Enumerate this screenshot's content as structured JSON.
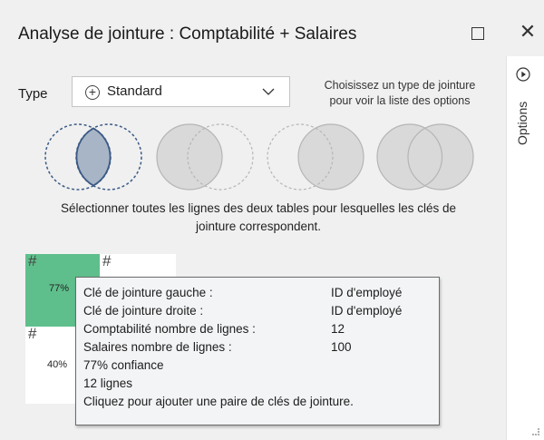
{
  "window": {
    "title": "Analyse de jointure : Comptabilité + Salaires",
    "maximize_icon": "maximize-icon",
    "close_icon": "close-icon",
    "close_glyph": "✕"
  },
  "join_type": {
    "label": "Type",
    "selected": "Standard",
    "hint_line1": "Choisissez un type de jointure",
    "hint_line2": "pour voir la liste des options",
    "options_visible": [
      "inner",
      "left",
      "right",
      "full-outer"
    ],
    "selected_venn": "inner"
  },
  "description": {
    "line1": "Sélectionner toutes les lignes des deux tables pour lesquelles les clés de",
    "line2": "jointure correspondent."
  },
  "grid": {
    "cells": [
      {
        "hash": "#",
        "pct": "77%",
        "color": "#5fbf8c"
      },
      {
        "hash": "#",
        "pct": "",
        "color": "#ffffff"
      },
      {
        "hash": "#",
        "pct": "40%",
        "color": "#ffffff"
      }
    ]
  },
  "tooltip": {
    "rows": [
      {
        "key": "Clé de jointure gauche :",
        "value": "ID d'employé"
      },
      {
        "key": "Clé de jointure droite :",
        "value": "ID d'employé"
      },
      {
        "key": "Comptabilité nombre de lignes :",
        "value": "12"
      },
      {
        "key": "Salaires nombre de lignes :",
        "value": "100"
      }
    ],
    "confidence": "77% confiance",
    "row_count": "12 lignes",
    "action": "Cliquez pour ajouter une paire de clés de jointure."
  },
  "sidebar": {
    "options_label": "Options",
    "options_icon": "play-circle-icon"
  },
  "colors": {
    "accent_green": "#5fbf8c",
    "venn_selected_fill": "#a7b5c6",
    "venn_stroke": "#3c5a86",
    "venn_gray": "#d9d9d9"
  }
}
